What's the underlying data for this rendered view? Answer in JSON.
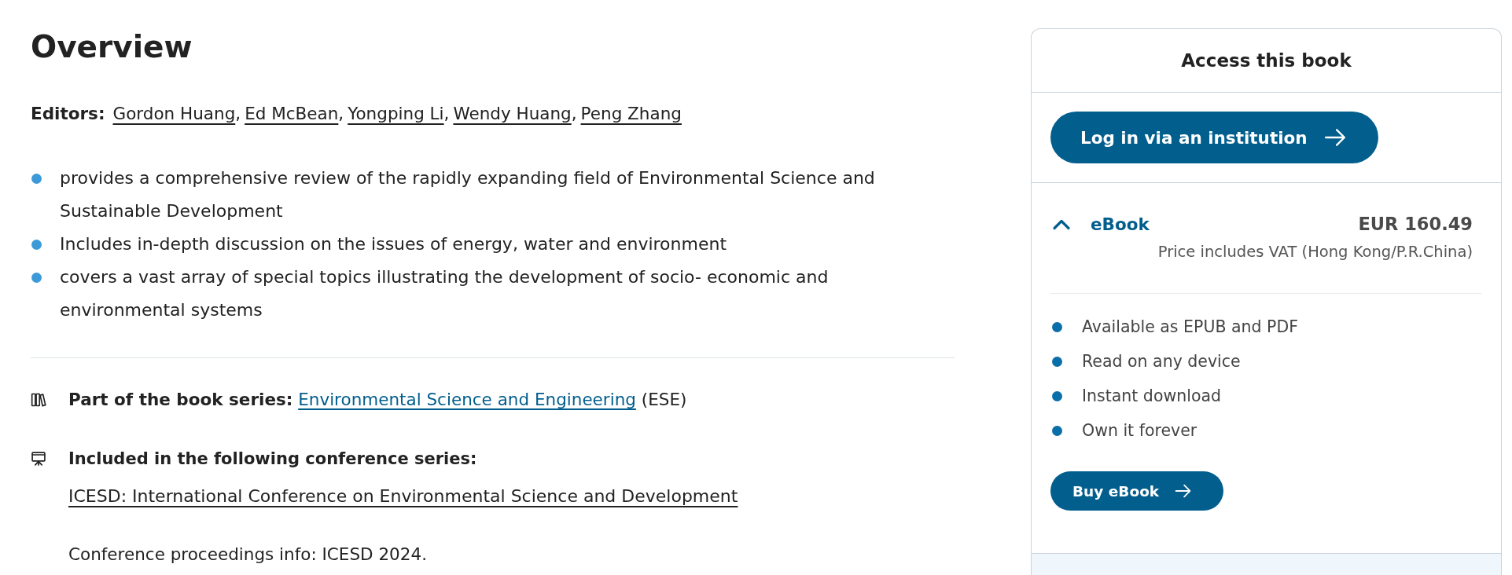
{
  "overview": {
    "title": "Overview",
    "editors_label": "Editors:",
    "editor_separator": ",",
    "editors": [
      "Gordon Huang",
      "Ed McBean",
      "Yongping Li",
      "Wendy Huang",
      "Peng Zhang"
    ],
    "highlights": [
      "provides a comprehensive review of the rapidly expanding field of Environmental Science and Sustainable Development",
      "Includes in-depth discussion on the issues of energy, water and environment",
      "covers a vast array of special topics illustrating the development of socio- economic and environmental systems"
    ],
    "book_series": {
      "label": "Part of the book series:",
      "link": "Environmental Science and Engineering",
      "abbreviation": "(ESE)"
    },
    "conference_series": {
      "label": "Included in the following conference series:",
      "link": "ICESD: International Conference on Environmental Science and Development",
      "info": "Conference proceedings info: ICESD 2024."
    }
  },
  "access": {
    "title": "Access this book",
    "login_button": "Log in via an institution",
    "offer": {
      "format": "eBook",
      "expanded": true,
      "price": "EUR 160.49",
      "price_note": "Price includes VAT (Hong Kong/P.R.China)",
      "features": [
        "Available as EPUB and PDF",
        "Read on any device",
        "Instant download",
        "Own it forever"
      ],
      "buy_button": "Buy eBook"
    }
  }
}
